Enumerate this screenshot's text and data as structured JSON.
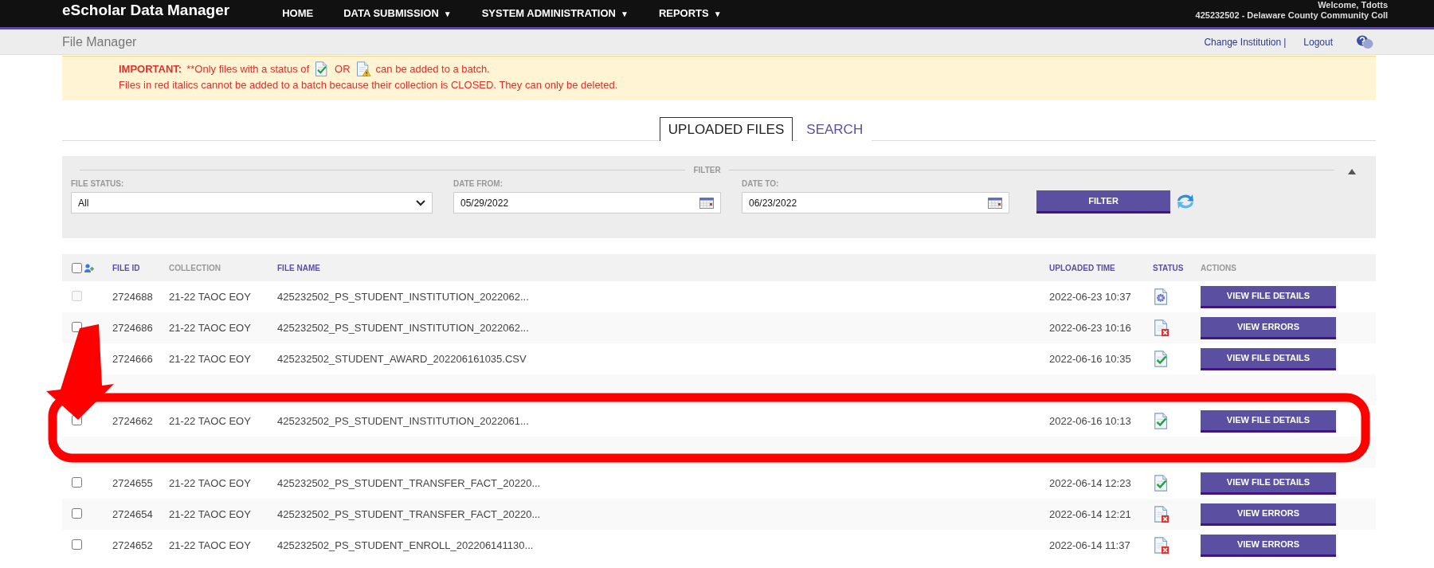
{
  "app": {
    "title": "eScholar Data Manager",
    "nav": [
      {
        "label": "HOME"
      },
      {
        "label": "DATA SUBMISSION",
        "caret": "▼"
      },
      {
        "label": "SYSTEM ADMINISTRATION",
        "caret": "▼"
      },
      {
        "label": "REPORTS",
        "caret": "▼"
      }
    ],
    "welcome": "Welcome, Tdotts",
    "institution": "425232502 - Delaware County Community Coll"
  },
  "subbar": {
    "title": "File Manager",
    "links": [
      "Change Institution",
      "Logout"
    ],
    "separator": "|"
  },
  "notice": {
    "label": "IMPORTANT:",
    "before": "**Only files with a status of",
    "conjunction": "OR",
    "after": "can be added to a batch.",
    "note": "Files in red italics cannot be added to a batch because their collection is CLOSED. They can only be deleted."
  },
  "tabs": [
    {
      "label": "UPLOADED FILES",
      "selected": true
    },
    {
      "label": "SEARCH",
      "selected": false
    }
  ],
  "filter": {
    "legend": "FILTER",
    "expanded": true,
    "status_label": "FILE STATUS:",
    "status_value": "All",
    "from_label": "DATE FROM:",
    "from_value": "05/29/2022",
    "to_label": "DATE TO:",
    "to_value": "06/23/2022",
    "button": "FILTER"
  },
  "table": {
    "select_all": {
      "checked": false
    },
    "columns": [
      {
        "label": "FILE ID",
        "sortable": true
      },
      {
        "label": "COLLECTION",
        "sortable": false
      },
      {
        "label": "FILE NAME",
        "sortable": true
      },
      {
        "label": "UPLOADED TIME",
        "sortable": true
      },
      {
        "label": "STATUS",
        "sortable": true
      },
      {
        "label": "ACTIONS",
        "sortable": false
      }
    ],
    "rows": [
      {
        "kind": "processing",
        "checked": false,
        "disabled": true,
        "file_id": "2724688",
        "collection": "21-22 TAOC EOY",
        "file_name": "425232502_PS_STUDENT_INSTITUTION_2022062...",
        "uploaded": "2022-06-23 10:37",
        "action": "VIEW FILE DETAILS"
      },
      {
        "kind": "error",
        "checked": false,
        "disabled": false,
        "file_id": "2724686",
        "collection": "21-22 TAOC EOY",
        "file_name": "425232502_PS_STUDENT_INSTITUTION_2022062...",
        "uploaded": "2022-06-23 10:16",
        "action": "VIEW ERRORS"
      },
      {
        "kind": "ok",
        "file_id": "2724666",
        "collection": "21-22 TAOC EOY",
        "file_name": "425232502_STUDENT_AWARD_202206161035.CSV",
        "uploaded": "2022-06-16 10:35",
        "action": "VIEW FILE DETAILS"
      },
      {
        "kind": "covered"
      },
      {
        "kind": "ok",
        "checked": false,
        "disabled": false,
        "file_id": "2724662",
        "collection": "21-22 TAOC EOY",
        "file_name": "425232502_PS_STUDENT_INSTITUTION_2022061...",
        "uploaded": "2022-06-16 10:13",
        "action": "VIEW FILE DETAILS"
      },
      {
        "kind": "covered"
      },
      {
        "kind": "ok",
        "checked": false,
        "disabled": false,
        "file_id": "2724655",
        "collection": "21-22 TAOC EOY",
        "file_name": "425232502_PS_STUDENT_TRANSFER_FACT_20220...",
        "uploaded": "2022-06-14 12:23",
        "action": "VIEW FILE DETAILS"
      },
      {
        "kind": "error",
        "checked": false,
        "disabled": false,
        "file_id": "2724654",
        "collection": "21-22 TAOC EOY",
        "file_name": "425232502_PS_STUDENT_TRANSFER_FACT_20220...",
        "uploaded": "2022-06-14 12:21",
        "action": "VIEW ERRORS"
      },
      {
        "kind": "error",
        "checked": false,
        "disabled": false,
        "file_id": "2724652",
        "collection": "21-22 TAOC EOY",
        "file_name": "425232502_PS_STUDENT_ENROLL_202206141130...",
        "uploaded": "2022-06-14 11:37",
        "action": "VIEW ERRORS"
      }
    ]
  }
}
